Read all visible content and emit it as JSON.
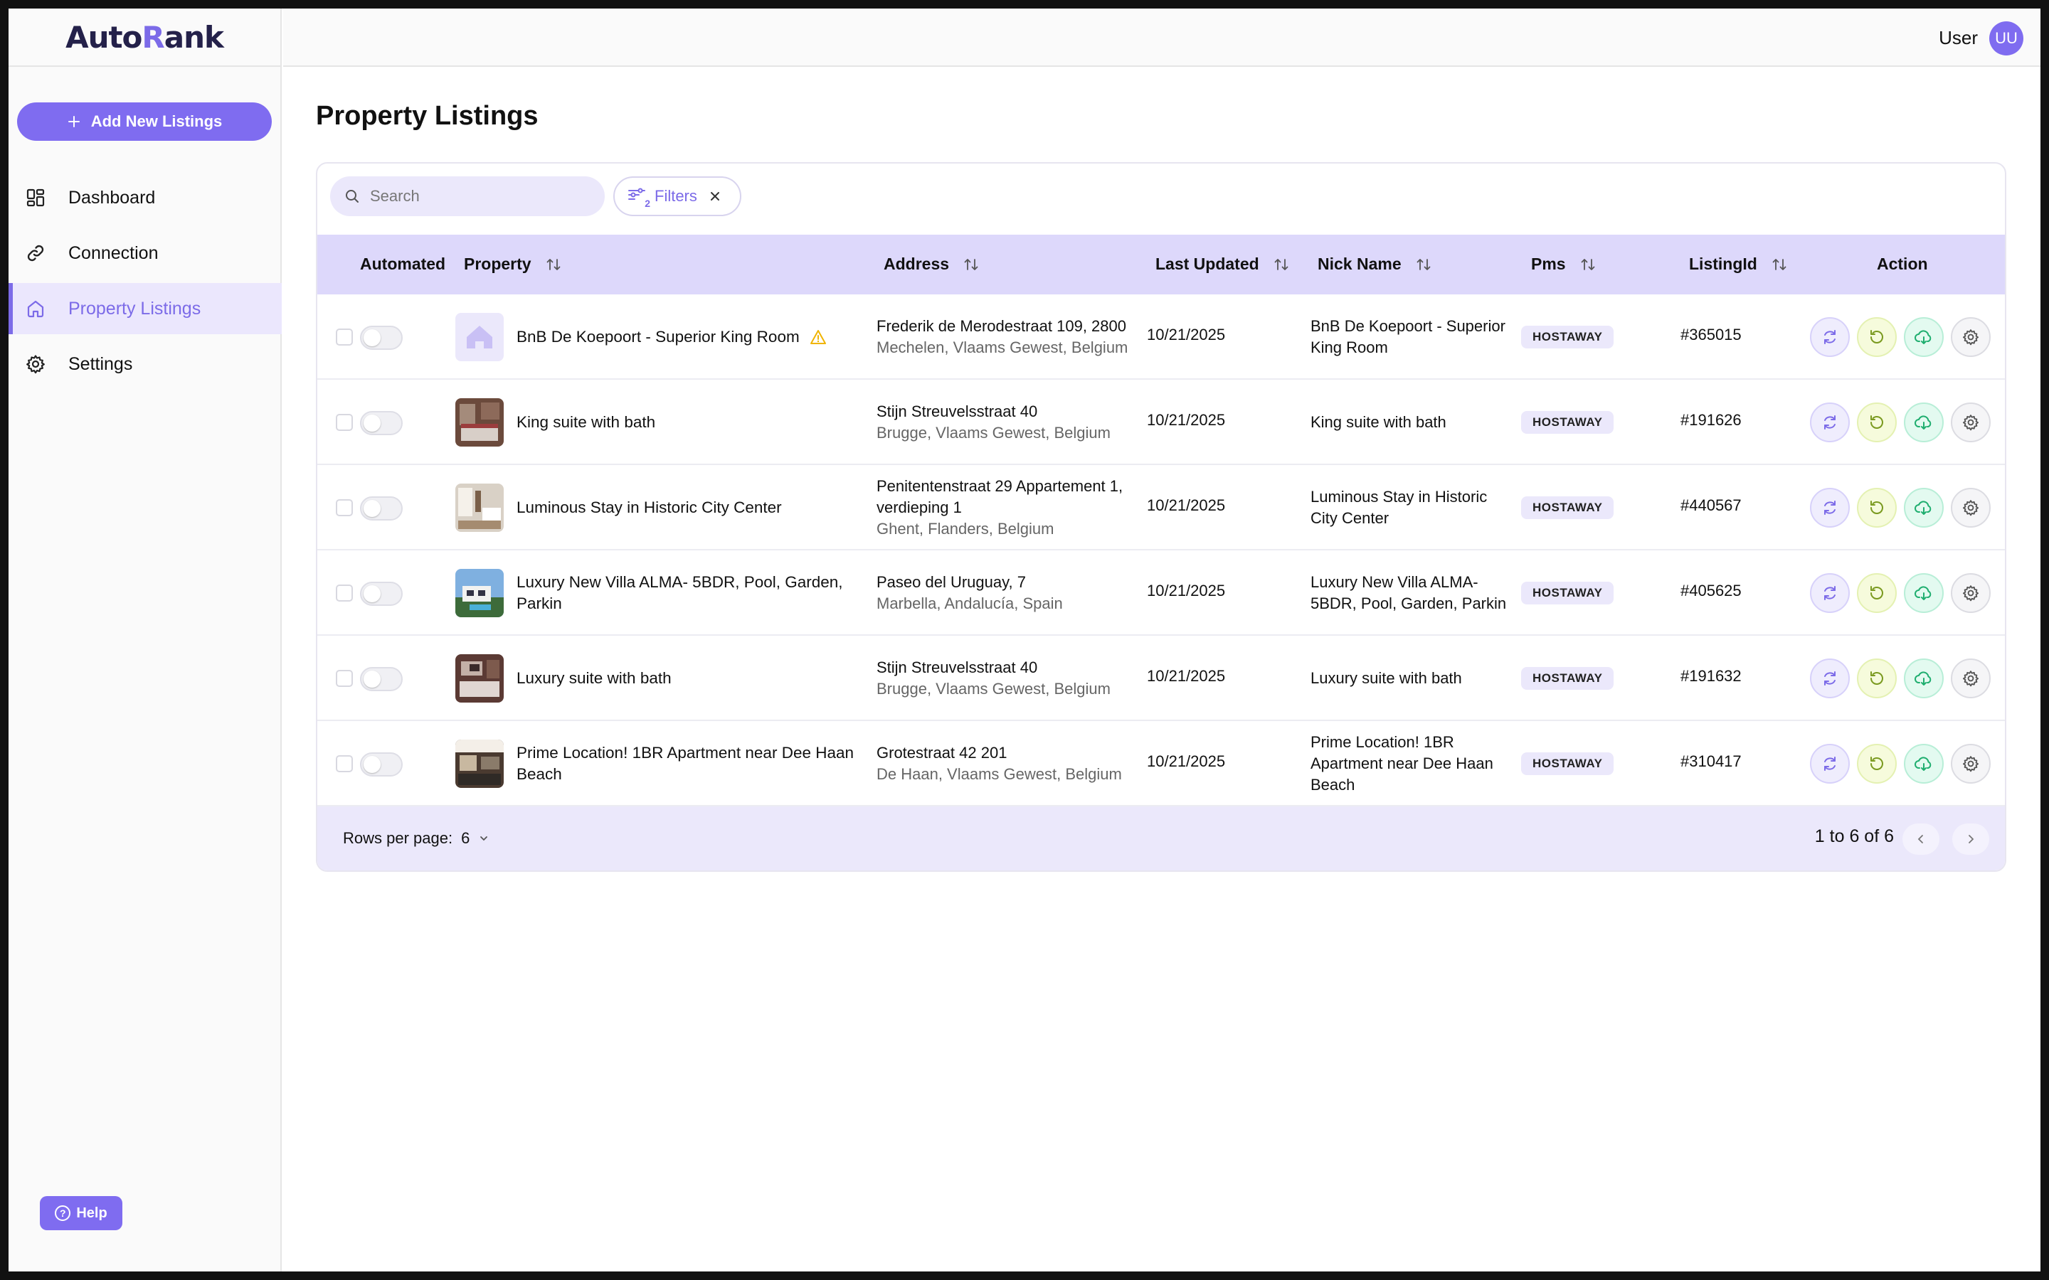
{
  "brand": {
    "prefix": "Auto",
    "r": "R",
    "suffix": "ank"
  },
  "sidebar": {
    "add_button": "Add New Listings",
    "items": [
      {
        "label": "Dashboard",
        "icon": "dashboard-icon"
      },
      {
        "label": "Connection",
        "icon": "link-icon"
      },
      {
        "label": "Property Listings",
        "icon": "home-icon",
        "active": true
      },
      {
        "label": "Settings",
        "icon": "gear-icon"
      }
    ],
    "help": "Help"
  },
  "header": {
    "user_name": "User",
    "avatar_initials": "UU"
  },
  "page": {
    "title": "Property Listings"
  },
  "toolbar": {
    "search_placeholder": "Search",
    "filters_label": "Filters",
    "filters_count": "2"
  },
  "table": {
    "columns": [
      "Automated",
      "Property",
      "Address",
      "Last Updated",
      "Nick Name",
      "Pms",
      "ListingId",
      "Action"
    ],
    "rows": [
      {
        "property": "BnB De Koepoort - Superior King Room",
        "warning": true,
        "address1": "Frederik de Merodestraat 109, 2800",
        "address2": "Mechelen, Vlaams Gewest, Belgium",
        "updated": "10/21/2025",
        "nick": "BnB De Koepoort - Superior King Room",
        "pms": "HOSTAWAY",
        "listing_id": "#365015",
        "thumb": "placeholder"
      },
      {
        "property": "King suite with bath",
        "address1": "Stijn Streuvelsstraat 40",
        "address2": "Brugge, Vlaams Gewest, Belgium",
        "updated": "10/21/2025",
        "nick": "King suite with bath",
        "pms": "HOSTAWAY",
        "listing_id": "#191626",
        "thumb": "bedroom"
      },
      {
        "property": "Luminous Stay in Historic City Center",
        "address1": "Penitentenstraat 29 Appartement 1, verdieping 1",
        "address2": "Ghent, Flanders, Belgium",
        "updated": "10/21/2025",
        "nick": "Luminous Stay in Historic City Center",
        "pms": "HOSTAWAY",
        "listing_id": "#440567",
        "thumb": "room"
      },
      {
        "property": "Luxury New Villa ALMA- 5BDR, Pool, Garden, Parkin",
        "address1": "Paseo del Uruguay, 7",
        "address2": "Marbella, Andalucía, Spain",
        "updated": "10/21/2025",
        "nick": "Luxury New Villa ALMA- 5BDR, Pool, Garden, Parkin",
        "pms": "HOSTAWAY",
        "listing_id": "#405625",
        "thumb": "villa"
      },
      {
        "property": "Luxury suite with bath",
        "address1": "Stijn Streuvelsstraat 40",
        "address2": "Brugge, Vlaams Gewest, Belgium",
        "updated": "10/21/2025",
        "nick": "Luxury suite with bath",
        "pms": "HOSTAWAY",
        "listing_id": "#191632",
        "thumb": "suite"
      },
      {
        "property": "Prime Location! 1BR Apartment near Dee Haan Beach",
        "address1": "Grotestraat 42 201",
        "address2": "De Haan, Vlaams Gewest, Belgium",
        "updated": "10/21/2025",
        "nick": "Prime Location! 1BR Apartment near Dee Haan Beach",
        "pms": "HOSTAWAY",
        "listing_id": "#310417",
        "thumb": "apartment"
      }
    ]
  },
  "footer": {
    "rows_per_page_label": "Rows per page:",
    "rows_per_page_value": "6",
    "pagination": "1 to 6 of 6"
  },
  "colors": {
    "accent": "#7f6cf0",
    "header_bg": "#ddd8fb"
  }
}
